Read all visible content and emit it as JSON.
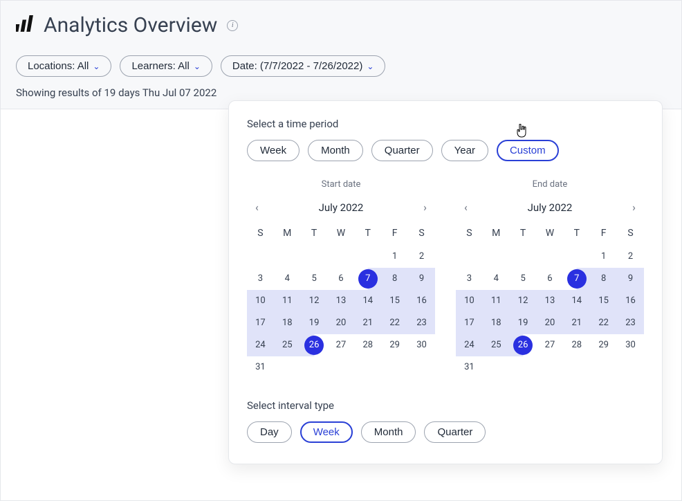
{
  "page_title": "Analytics Overview",
  "filters": {
    "locations": "Locations: All",
    "learners": "Learners: All",
    "date": "Date: (7/7/2022 - 7/26/2022)"
  },
  "results_text": "Showing results of 19 days Thu Jul 07 2022",
  "popover": {
    "period_label": "Select a time period",
    "periods": [
      "Week",
      "Month",
      "Quarter",
      "Year",
      "Custom"
    ],
    "selected_period": "Custom",
    "interval_label": "Select interval type",
    "intervals": [
      "Day",
      "Week",
      "Month",
      "Quarter"
    ],
    "selected_interval": "Week",
    "calendars": {
      "start": {
        "label": "Start date",
        "month": "July 2022",
        "dow": [
          "S",
          "M",
          "T",
          "W",
          "T",
          "F",
          "S"
        ],
        "weeks": [
          [
            "",
            "",
            "",
            "",
            "",
            "1",
            "2"
          ],
          [
            "3",
            "4",
            "5",
            "6",
            "7",
            "8",
            "9"
          ],
          [
            "10",
            "11",
            "12",
            "13",
            "14",
            "15",
            "16"
          ],
          [
            "17",
            "18",
            "19",
            "20",
            "21",
            "22",
            "23"
          ],
          [
            "24",
            "25",
            "26",
            "27",
            "28",
            "29",
            "30"
          ],
          [
            "31",
            "",
            "",
            "",
            "",
            "",
            ""
          ]
        ],
        "selected": [
          7,
          26
        ],
        "range": [
          7,
          26
        ]
      },
      "end": {
        "label": "End date",
        "month": "July 2022",
        "dow": [
          "S",
          "M",
          "T",
          "W",
          "T",
          "F",
          "S"
        ],
        "weeks": [
          [
            "",
            "",
            "",
            "",
            "",
            "1",
            "2"
          ],
          [
            "3",
            "4",
            "5",
            "6",
            "7",
            "8",
            "9"
          ],
          [
            "10",
            "11",
            "12",
            "13",
            "14",
            "15",
            "16"
          ],
          [
            "17",
            "18",
            "19",
            "20",
            "21",
            "22",
            "23"
          ],
          [
            "24",
            "25",
            "26",
            "27",
            "28",
            "29",
            "30"
          ],
          [
            "31",
            "",
            "",
            "",
            "",
            "",
            ""
          ]
        ],
        "selected": [
          7,
          26
        ],
        "range": [
          7,
          26
        ]
      }
    }
  }
}
